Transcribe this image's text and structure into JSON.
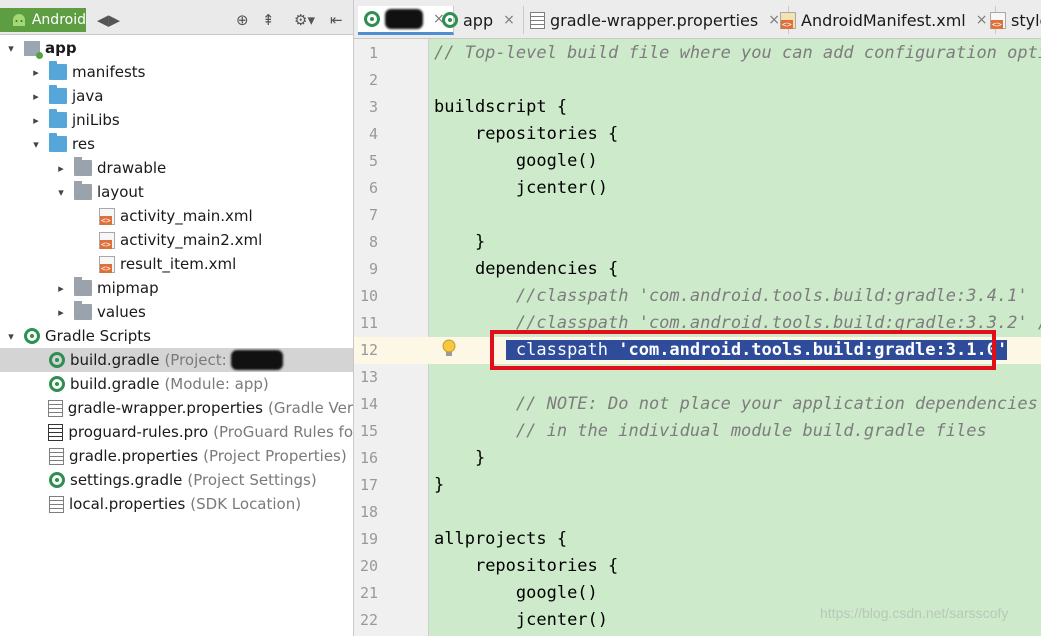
{
  "project_panel": {
    "view_selector": "Android",
    "tree": [
      {
        "label": "app",
        "bold": true,
        "arrow": "▾",
        "icon": "module-icon",
        "indent": 0
      },
      {
        "label": "manifests",
        "arrow": "▸",
        "icon": "folder-icon",
        "indent": 1
      },
      {
        "label": "java",
        "arrow": "▸",
        "icon": "folder-icon",
        "indent": 1
      },
      {
        "label": "jniLibs",
        "arrow": "▸",
        "icon": "folder-icon",
        "indent": 1
      },
      {
        "label": "res",
        "arrow": "▾",
        "icon": "folder-icon",
        "indent": 1
      },
      {
        "label": "drawable",
        "arrow": "▸",
        "icon": "res-folder-icon",
        "indent": 2
      },
      {
        "label": "layout",
        "arrow": "▾",
        "icon": "res-folder-icon",
        "indent": 2
      },
      {
        "label": "activity_main.xml",
        "arrow": "",
        "icon": "xml-file-icon",
        "indent": 3
      },
      {
        "label": "activity_main2.xml",
        "arrow": "",
        "icon": "xml-file-icon",
        "indent": 3
      },
      {
        "label": "result_item.xml",
        "arrow": "",
        "icon": "xml-file-icon",
        "indent": 3
      },
      {
        "label": "mipmap",
        "arrow": "▸",
        "icon": "res-folder-icon",
        "indent": 2
      },
      {
        "label": "values",
        "arrow": "▸",
        "icon": "res-folder-icon",
        "indent": 2
      },
      {
        "label": "Gradle Scripts",
        "arrow": "▾",
        "icon": "gradle-icon",
        "indent": 0
      },
      {
        "label": "build.gradle",
        "hint": "(Project:",
        "redacted": true,
        "selected": true,
        "icon": "gradle-icon",
        "indent": 1
      },
      {
        "label": "build.gradle",
        "hint": "(Module: app)",
        "icon": "gradle-icon",
        "indent": 1
      },
      {
        "label": "gradle-wrapper.properties",
        "hint": "(Gradle Ver",
        "icon": "properties-file-icon",
        "indent": 1
      },
      {
        "label": "proguard-rules.pro",
        "hint": "(ProGuard Rules fo",
        "icon": "pro-file-icon",
        "indent": 1
      },
      {
        "label": "gradle.properties",
        "hint": "(Project Properties)",
        "icon": "properties-file-icon",
        "indent": 1
      },
      {
        "label": "settings.gradle",
        "hint": "(Project Settings)",
        "icon": "gradle-icon",
        "indent": 1
      },
      {
        "label": "local.properties",
        "hint": "(SDK Location)",
        "icon": "properties-file-icon",
        "indent": 1
      }
    ]
  },
  "editor_tabs": [
    {
      "label": "",
      "redacted": true,
      "icon": "gradle-icon",
      "active": true
    },
    {
      "label": "app",
      "icon": "gradle-icon"
    },
    {
      "label": "gradle-wrapper.properties",
      "icon": "properties-file-icon"
    },
    {
      "label": "AndroidManifest.xml",
      "icon": "manifest-file-icon"
    },
    {
      "label": "style",
      "icon": "xml-file-icon"
    }
  ],
  "code_lines": [
    {
      "n": "1",
      "text": "// Top-level build file where you can add configuration optio",
      "kind": "comment"
    },
    {
      "n": "2",
      "text": ""
    },
    {
      "n": "3",
      "text": "buildscript {"
    },
    {
      "n": "4",
      "text": "    repositories {"
    },
    {
      "n": "5",
      "text": "        google()"
    },
    {
      "n": "6",
      "text": "        jcenter()"
    },
    {
      "n": "7",
      "text": ""
    },
    {
      "n": "8",
      "text": "    }"
    },
    {
      "n": "9",
      "text": "    dependencies {"
    },
    {
      "n": "10",
      "text": "        //classpath 'com.android.tools.build:gradle:3.4.1'",
      "kind": "comment"
    },
    {
      "n": "11",
      "text": "        //classpath 'com.android.tools.build:gradle:3.3.2' //",
      "kind": "comment"
    },
    {
      "n": "12",
      "keyword": "classpath",
      "string": "'com.android.tools.build:gradle:3.1.0'",
      "kind": "selected"
    },
    {
      "n": "13",
      "text": ""
    },
    {
      "n": "14",
      "text": "        // NOTE: Do not place your application dependencies h",
      "kind": "comment"
    },
    {
      "n": "15",
      "text": "        // in the individual module build.gradle files",
      "kind": "comment"
    },
    {
      "n": "16",
      "text": "    }"
    },
    {
      "n": "17",
      "text": "}"
    },
    {
      "n": "18",
      "text": ""
    },
    {
      "n": "19",
      "text": "allprojects {"
    },
    {
      "n": "20",
      "text": "    repositories {"
    },
    {
      "n": "21",
      "text": "        google()"
    },
    {
      "n": "22",
      "text": "        jcenter()"
    }
  ],
  "watermark": "https://blog.csdn.net/sarsscofy",
  "colors": {
    "editor_bg": "#cdeacb",
    "selection": "#2f4c9a",
    "highlight_box": "#e00f1a",
    "android_green": "#5e9e43"
  }
}
